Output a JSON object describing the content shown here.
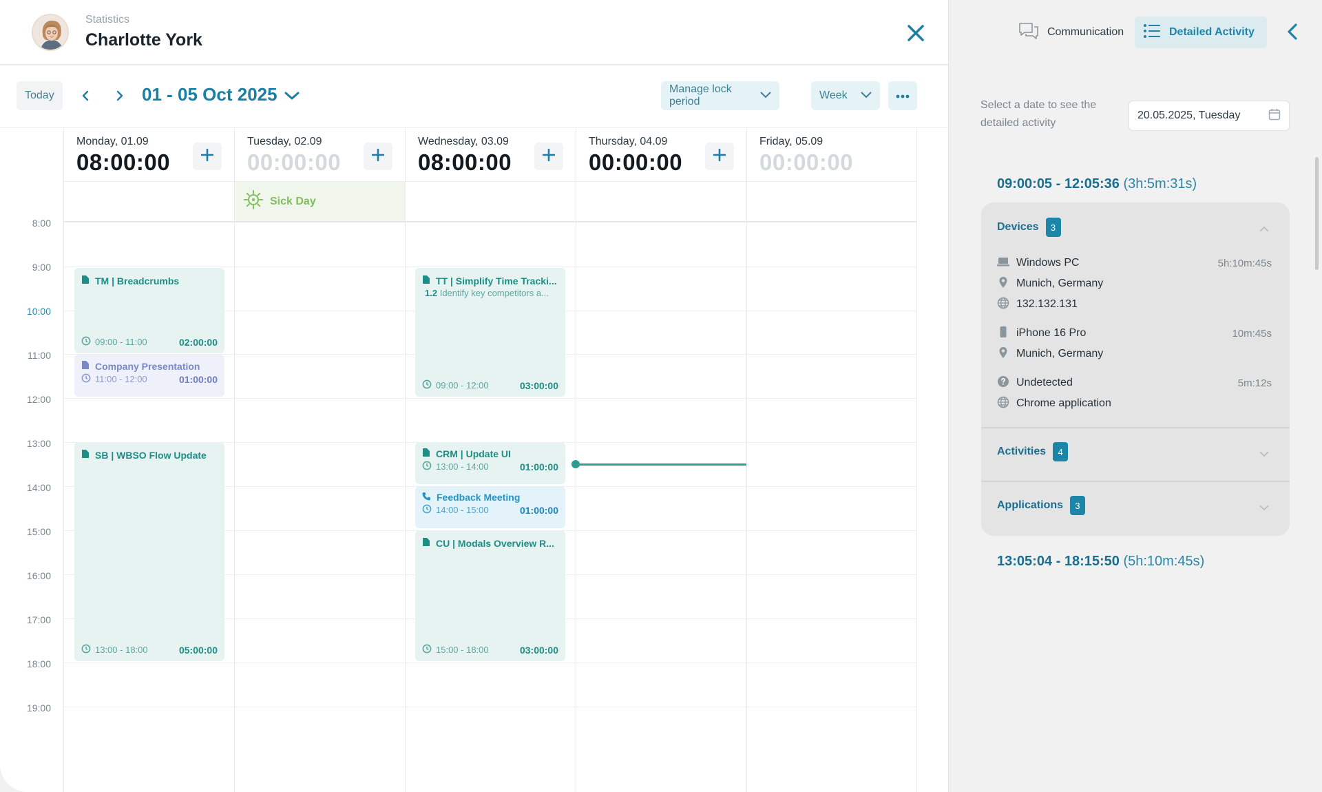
{
  "header": {
    "breadcrumb": "Statistics",
    "title": "Charlotte York"
  },
  "toolbar": {
    "today_label": "Today",
    "date_range": "01 - 05 Oct 2025",
    "lock_period_label": "Manage lock period",
    "view_label": "Week"
  },
  "calendar": {
    "times": [
      "8:00",
      "9:00",
      "10:00",
      "11:00",
      "12:00",
      "13:00",
      "14:00",
      "15:00",
      "16:00",
      "17:00",
      "18:00",
      "19:00"
    ],
    "days": [
      {
        "name": "Monday, 01.09",
        "total": "08:00:00"
      },
      {
        "name": "Tuesday, 02.09",
        "total": "00:00:00"
      },
      {
        "name": "Wednesday, 03.09",
        "total": "08:00:00"
      },
      {
        "name": "Thursday, 04.09",
        "total": "00:00:00"
      },
      {
        "name": "Friday, 05.09",
        "total": "00:00:00"
      }
    ],
    "sick_day": "Sick Day",
    "events": [
      {
        "title": "TM |  Breadcrumbs",
        "time": "09:00 - 11:00",
        "duration": "02:00:00"
      },
      {
        "title": "Company Presentation",
        "time": "11:00 - 12:00",
        "duration": "01:00:00"
      },
      {
        "title": "SB | WBSO Flow Update",
        "time": "13:00 - 18:00",
        "duration": "05:00:00"
      },
      {
        "title": "TT | Simplify Time Tracki...",
        "sub_num": "1.2",
        "sub_text": "Identify key competitors a...",
        "time": "09:00 - 12:00",
        "duration": "03:00:00"
      },
      {
        "title": "CRM | Update UI",
        "time": "13:00 - 14:00",
        "duration": "01:00:00"
      },
      {
        "title": "Feedback Meeting",
        "time": "14:00 - 15:00",
        "duration": "01:00:00"
      },
      {
        "title": "CU | Modals Overview R...",
        "time": "15:00 - 18:00",
        "duration": "03:00:00"
      }
    ]
  },
  "side": {
    "tab_communication": "Communication",
    "tab_detailed": "Detailed Activity",
    "date_hint": "Select a date to see the detailed activity",
    "date_value": "20.05.2025, Tuesday",
    "range1_time": "09:00:05 - 12:05:36",
    "range1_dur": "(3h:5m:31s)",
    "range2_time": "13:05:04 - 18:15:50",
    "range2_dur": "(5h:10m:45s)",
    "devices_label": "Devices",
    "devices_count": "3",
    "activities_label": "Activities",
    "activities_count": "4",
    "applications_label": "Applications",
    "applications_count": "3",
    "device_rows": [
      {
        "text": "Windows PC",
        "value": "5h:10m:45s"
      },
      {
        "text": "Munich, Germany"
      },
      {
        "text": "132.132.131"
      },
      {
        "text": "iPhone 16 Pro",
        "value": "10m:45s"
      },
      {
        "text": "Munich, Germany"
      },
      {
        "text": "Undetected",
        "value": "5m:12s"
      },
      {
        "text": "Chrome application"
      }
    ]
  }
}
